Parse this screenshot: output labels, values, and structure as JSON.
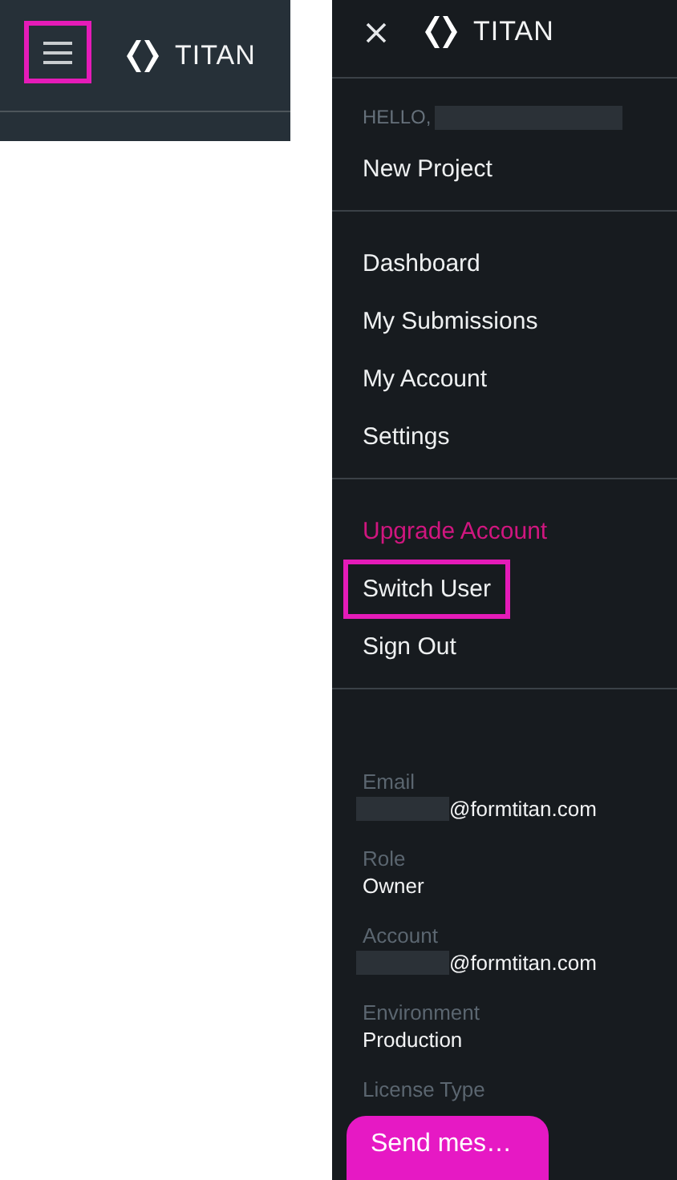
{
  "top_bar": {
    "menu_highlighted": true,
    "logo_text": "TITAN"
  },
  "sidebar": {
    "logo_text": "TITAN",
    "greeting": "HELLO,",
    "greeting_redacted": true,
    "sections": [
      [
        {
          "label": "New Project",
          "kind": "normal",
          "highlighted": false
        }
      ],
      [
        {
          "label": "Dashboard",
          "kind": "normal",
          "highlighted": false
        },
        {
          "label": "My Submissions",
          "kind": "normal",
          "highlighted": false
        },
        {
          "label": "My Account",
          "kind": "normal",
          "highlighted": false
        },
        {
          "label": "Settings",
          "kind": "normal",
          "highlighted": false
        }
      ],
      [
        {
          "label": "Upgrade Account",
          "kind": "accent",
          "highlighted": false
        },
        {
          "label": "Switch User",
          "kind": "normal",
          "highlighted": true
        },
        {
          "label": "Sign Out",
          "kind": "normal",
          "highlighted": false
        }
      ]
    ],
    "info": [
      {
        "label": "Email",
        "value": "@formtitan.com",
        "redacted": true
      },
      {
        "label": "Role",
        "value": "Owner"
      },
      {
        "label": "Account",
        "value": "@formtitan.com",
        "redacted": true
      },
      {
        "label": "Environment",
        "value": "Production"
      },
      {
        "label": "License Type"
      }
    ]
  },
  "chat_button": "Send mes…"
}
